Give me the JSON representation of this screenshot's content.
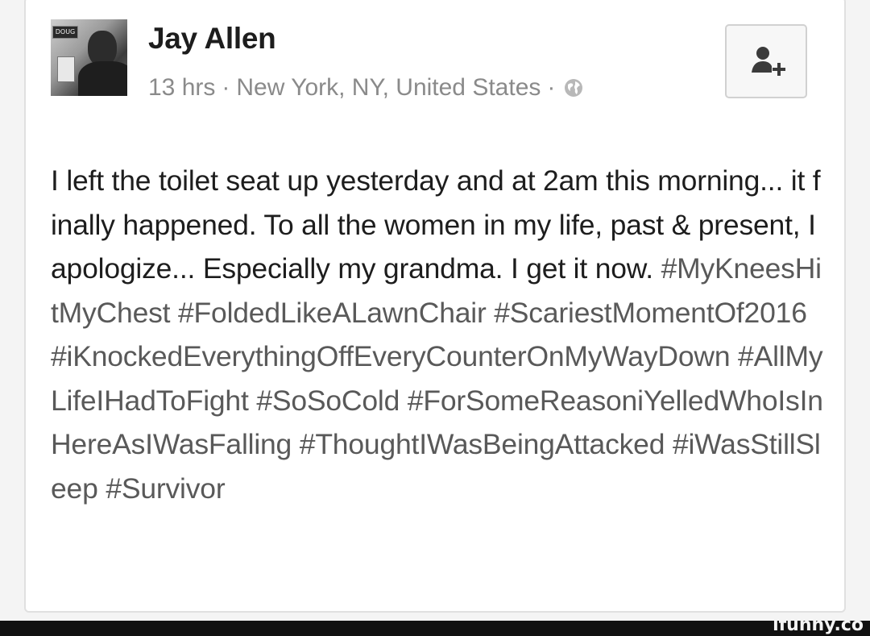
{
  "post": {
    "author": "Jay Allen",
    "timestamp": "13 hrs",
    "separator": "·",
    "location": "New York, NY, United States",
    "privacy_icon": "globe-icon",
    "add_friend_icon": "add-friend-icon",
    "avatar_sign_text": "DOUG",
    "text_plain": "I left the toilet seat up yesterday and at 2am this morning... it finally happened. To all the women in my life, past & present, I apologize... Especially my grandma. I get it now.",
    "hashtags": [
      "#MyKneesHitMyChest",
      "#FoldedLikeALawnChair",
      "#ScariestMomentOf2016",
      "#iKnockedEverythingOffEveryCounterOnMyWayDown",
      "#AllMyLifeIHadToFight",
      "#SoSoCold",
      "#ForSomeReasoniYelledWhoIsInHereAsIWasFalling",
      "#ThoughtIWasBeingAttacked",
      "#iWasStillSleep",
      "#Survivor"
    ]
  },
  "watermark": "ifunny.co",
  "colors": {
    "hashtag": "#4a5a80",
    "meta": "#8a8a8a",
    "text": "#1d1d1d"
  }
}
